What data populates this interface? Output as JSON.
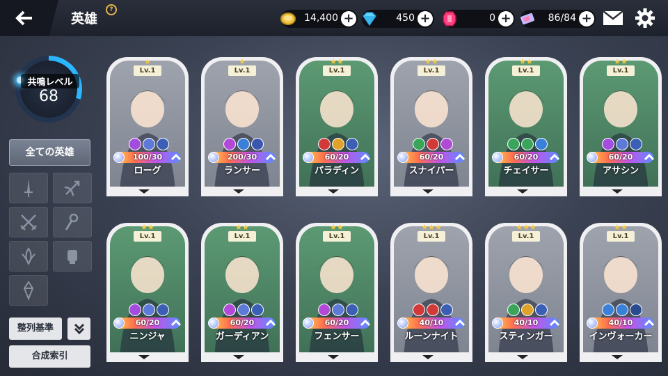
{
  "header": {
    "title": "英雄",
    "help_badge": "?",
    "resources": [
      {
        "name": "gold",
        "value": "14,400",
        "color": "#f4c542"
      },
      {
        "name": "diamond",
        "value": "450",
        "color": "#5fd4ff"
      },
      {
        "name": "ruby",
        "value": "0",
        "color": "#ff3d7f"
      },
      {
        "name": "ticket",
        "value": "86/84",
        "color": "#c7b7ff"
      }
    ]
  },
  "left_panel": {
    "resonance_label": "共鳴レベル",
    "resonance_level": "68",
    "all_heroes_label": "全ての英雄",
    "filters": [
      "sword-filter",
      "bow-filter",
      "dagger-filter",
      "staff-filter",
      "leaf-filter",
      "fist-filter",
      "crystal-filter"
    ],
    "sort_label": "整列基準",
    "synthesis_index_label": "合成索引"
  },
  "cards": [
    {
      "name": "ローグ",
      "level": "Lv.1",
      "stars": "★",
      "stat": "100/30",
      "bg": "gray",
      "elements": [
        "#a34de0",
        "#5d7ad8",
        "#3b5fb5"
      ]
    },
    {
      "name": "ランサー",
      "level": "Lv.1",
      "stars": "★",
      "stat": "200/30",
      "bg": "gray",
      "elements": [
        "#b24ad8",
        "#3a80d8",
        "#3a56b0"
      ]
    },
    {
      "name": "パラディン",
      "level": "Lv.1",
      "stars": "★★",
      "stat": "60/20",
      "bg": "green",
      "elements": [
        "#d23a3a",
        "#e0a22a",
        "#3a5fb5"
      ]
    },
    {
      "name": "スナイパー",
      "level": "Lv.1",
      "stars": "★★",
      "stat": "60/20",
      "bg": "gray",
      "elements": [
        "#3aa55a",
        "#d23a3a",
        "#b24ad8"
      ]
    },
    {
      "name": "チェイサー",
      "level": "Lv.1",
      "stars": "★★",
      "stat": "60/20",
      "bg": "green",
      "elements": [
        "#3aa55a",
        "#3aa55a",
        "#3a80d8"
      ]
    },
    {
      "name": "アサシン",
      "level": "Lv.1",
      "stars": "★★",
      "stat": "60/20",
      "bg": "green",
      "elements": [
        "#a34de0",
        "#5d7ad8",
        "#3b5fb5"
      ]
    },
    {
      "name": "ニンジャ",
      "level": "Lv.1",
      "stars": "★★",
      "stat": "60/20",
      "bg": "green",
      "elements": [
        "#a34de0",
        "#5d7ad8",
        "#3b5fb5"
      ]
    },
    {
      "name": "ガーディアン",
      "level": "Lv.1",
      "stars": "★★",
      "stat": "60/20",
      "bg": "green",
      "elements": [
        "#b24ad8",
        "#5d7ad8",
        "#3b5fb5"
      ]
    },
    {
      "name": "フェンサー",
      "level": "Lv.1",
      "stars": "★★",
      "stat": "60/20",
      "bg": "green",
      "elements": [
        "#b24ad8",
        "#5d7ad8",
        "#3b5fb5"
      ]
    },
    {
      "name": "ルーンナイト",
      "level": "Lv.1",
      "stars": "★★★",
      "stat": "40/10",
      "bg": "gray",
      "elements": [
        "#d23a3a",
        "#d23a3a",
        "#3b5fb5"
      ]
    },
    {
      "name": "スティンガー",
      "level": "Lv.1",
      "stars": "★★★",
      "stat": "40/10",
      "bg": "gray",
      "elements": [
        "#3aa55a",
        "#e0a22a",
        "#3b5fb5"
      ]
    },
    {
      "name": "インヴォーカー",
      "level": "Lv.1",
      "stars": "★★",
      "stat": "40/10",
      "bg": "gray",
      "elements": [
        "#3a80d8",
        "#3a80d8",
        "#2a4b90"
      ]
    }
  ]
}
